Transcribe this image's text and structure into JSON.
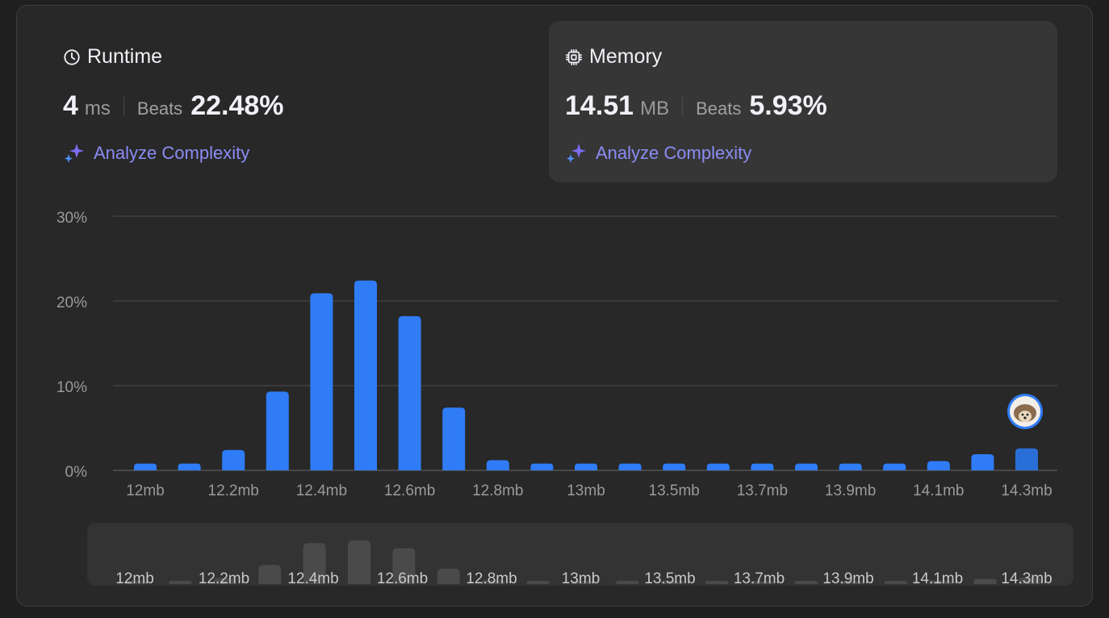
{
  "runtime": {
    "title": "Runtime",
    "value": "4",
    "unit": "ms",
    "beats_label": "Beats",
    "beats_value": "22.48%",
    "analyze_label": "Analyze Complexity"
  },
  "memory": {
    "title": "Memory",
    "value": "14.51",
    "unit": "MB",
    "beats_label": "Beats",
    "beats_value": "5.93%",
    "analyze_label": "Analyze Complexity"
  },
  "chart_data": {
    "type": "bar",
    "y_ticks": [
      "30%",
      "20%",
      "10%",
      "0%"
    ],
    "ylim": [
      0,
      30
    ],
    "grid": true,
    "x_tick_labels": [
      "12mb",
      "12.2mb",
      "12.4mb",
      "12.6mb",
      "12.8mb",
      "13mb",
      "13.5mb",
      "13.7mb",
      "13.9mb",
      "14.1mb",
      "14.3mb"
    ],
    "values": [
      0.8,
      0.8,
      2.4,
      9.3,
      20.9,
      22.4,
      18.2,
      7.4,
      1.2,
      0.8,
      0.8,
      0.8,
      0.8,
      0.8,
      0.8,
      0.8,
      0.8,
      0.8,
      1.1,
      1.9,
      2.6
    ],
    "highlight_index": 20,
    "colors": {
      "bar": "#2f7cf6",
      "highlight": "#2a6fd8",
      "grid": "#444444",
      "axis": "#5a5a5a",
      "tick": "#9a9a9a",
      "minimap_bar": "#4a4a4a",
      "minimap_bg": "#333333"
    },
    "marker_icon": "hedgehog-avatar-icon"
  }
}
